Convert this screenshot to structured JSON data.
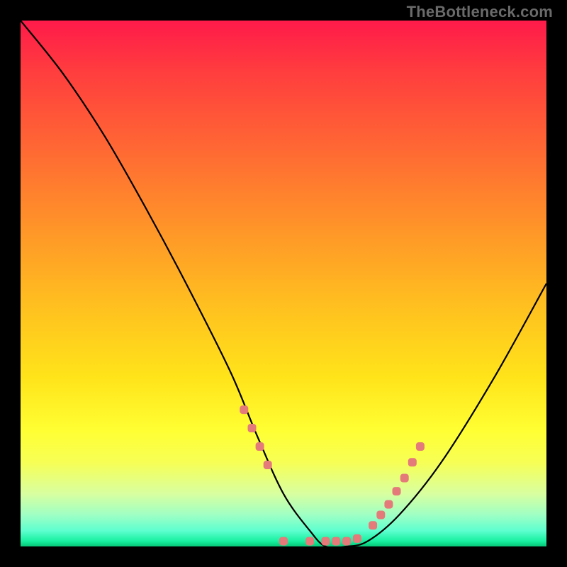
{
  "attribution": "TheBottleneck.com",
  "chart_data": {
    "type": "line",
    "title": "",
    "xlabel": "",
    "ylabel": "",
    "xlim": [
      0,
      100
    ],
    "ylim": [
      0,
      100
    ],
    "series": [
      {
        "name": "bottleneck-curve",
        "x": [
          0,
          8,
          16,
          24,
          32,
          40,
          45,
          50,
          55,
          58,
          62,
          66,
          72,
          80,
          90,
          100
        ],
        "y": [
          100,
          90,
          78,
          64,
          49,
          33,
          21,
          10,
          3,
          0,
          0,
          1,
          6,
          16,
          32,
          50
        ]
      }
    ],
    "markers": {
      "name": "highlight-dots",
      "color": "#e47a7a",
      "x": [
        42.5,
        44.0,
        45.5,
        47.0,
        50.0,
        55.0,
        58.0,
        60.0,
        62.0,
        64.0,
        67.0,
        68.5,
        70.0,
        71.5,
        73.0,
        74.5,
        76.0
      ],
      "y": [
        26.0,
        22.5,
        19.0,
        15.5,
        1.0,
        1.0,
        1.0,
        1.0,
        1.0,
        1.5,
        4.0,
        6.0,
        8.0,
        10.5,
        13.0,
        16.0,
        19.0
      ]
    }
  }
}
